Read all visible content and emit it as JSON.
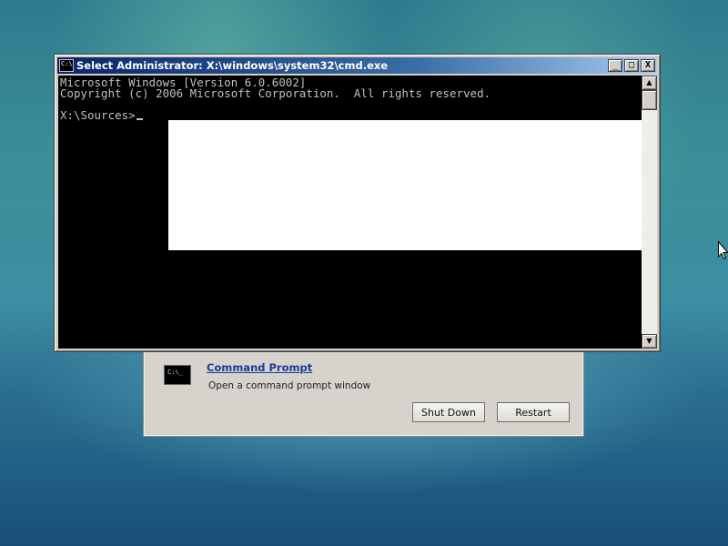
{
  "window": {
    "title": "Select Administrator: X:\\windows\\system32\\cmd.exe",
    "icon": "cmd-window-icon",
    "controls": {
      "minimize": "_",
      "maximize": "□",
      "close": "X"
    }
  },
  "console": {
    "lines": [
      "Microsoft Windows [Version 6.0.6002]",
      "Copyright (c) 2006 Microsoft Corporation.  All rights reserved.",
      "",
      "X:\\Sources>"
    ],
    "text_color": "#c0c0c0",
    "background": "#000000"
  },
  "scrollbar": {
    "up_arrow": "▲",
    "down_arrow": "▼"
  },
  "recovery_panel": {
    "item": {
      "thumbnail_text": "C:\\_",
      "title": "Command Prompt",
      "description": "Open a command prompt window"
    },
    "buttons": {
      "shut_down": "Shut Down",
      "restart": "Restart"
    }
  }
}
